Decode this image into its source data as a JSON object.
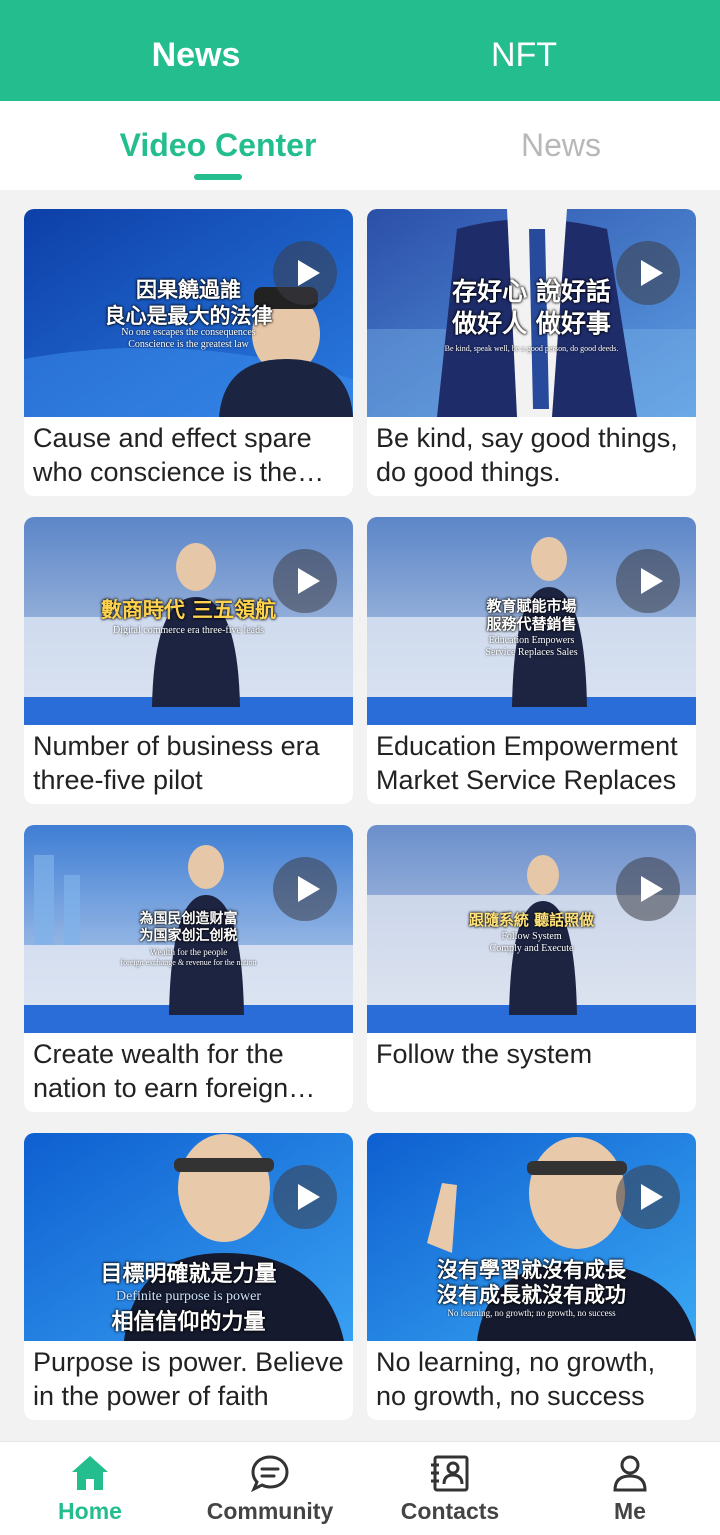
{
  "header": {
    "tabs": [
      {
        "label": "News",
        "active": true
      },
      {
        "label": "NFT",
        "active": false
      }
    ],
    "accent_color": "#24bd8e"
  },
  "subtabs": [
    {
      "label": "Video Center",
      "active": true
    },
    {
      "label": "News",
      "active": false
    }
  ],
  "videos": [
    {
      "title": "Cause and effect spare who conscience is the greatest law",
      "overlay_zh": [
        "因果饒過誰",
        "良心是最大的法律"
      ],
      "overlay_en": [
        "No one escapes the consequences",
        "Conscience is the greatest law"
      ]
    },
    {
      "title": "Be kind, say good things, do good things.",
      "overlay_zh": [
        "存好心 說好話",
        "做好人 做好事"
      ],
      "overlay_en": [
        "Be kind, speak well, be a good person, do good deeds."
      ]
    },
    {
      "title": "Number of business era three-five pilot",
      "overlay_zh": [
        "數商時代 三五領航"
      ],
      "overlay_en": [
        "Digital commerce era three-five leads"
      ]
    },
    {
      "title": "Education Empowerment Market Service Replaces",
      "overlay_zh": [
        "教育賦能市場",
        "服務代替銷售"
      ],
      "overlay_en": [
        "Education Empowers",
        "Service Replaces Sales"
      ]
    },
    {
      "title": "Create wealth for the nation to earn foreign exchange",
      "overlay_zh": [
        "為国民创造财富",
        "为国家创汇创税"
      ],
      "overlay_en": [
        "Wealth for the people",
        "foreign exchange & revenue for the nation"
      ]
    },
    {
      "title": "Follow the system",
      "overlay_zh": [
        "跟隨系統 聽話照做"
      ],
      "overlay_en": [
        "Follow System",
        "Comply and Execute"
      ]
    },
    {
      "title": "Purpose is power. Believe in the power of faith",
      "overlay_zh": [
        "目標明確就是力量",
        "相信信仰的力量"
      ],
      "overlay_en": [
        "Definite purpose is power"
      ]
    },
    {
      "title": "No learning, no growth, no growth, no success",
      "overlay_zh": [
        "沒有學習就沒有成長",
        "沒有成長就沒有成功"
      ],
      "overlay_en": [
        "No learning, no growth; no growth, no success"
      ]
    }
  ],
  "bottom_nav": [
    {
      "label": "Home",
      "icon": "home-icon",
      "active": true
    },
    {
      "label": "Community",
      "icon": "chat-bubble-icon",
      "active": false
    },
    {
      "label": "Contacts",
      "icon": "contacts-book-icon",
      "active": false
    },
    {
      "label": "Me",
      "icon": "person-icon",
      "active": false
    }
  ]
}
